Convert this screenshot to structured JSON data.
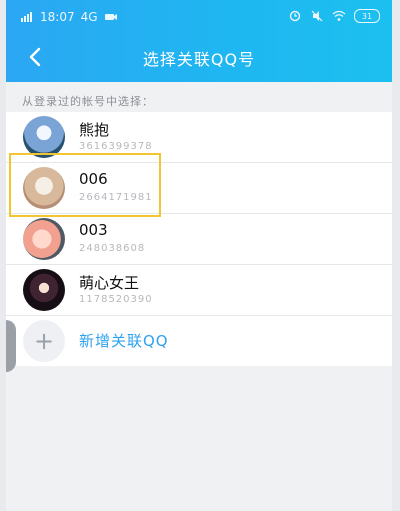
{
  "status_bar": {
    "time": "18:07",
    "network": "4G",
    "battery": "31"
  },
  "header": {
    "title": "选择关联QQ号"
  },
  "hint": "从登录过的帐号中选择：",
  "accounts": [
    {
      "name": "熊抱",
      "number": "3616399378",
      "avatar": "avatar-person-icon"
    },
    {
      "name": "006",
      "number": "2664171981",
      "avatar": "avatar-cat-icon"
    },
    {
      "name": "003",
      "number": "248038608",
      "avatar": "avatar-face-icon"
    },
    {
      "name": "萌心女王",
      "number": "1178520390",
      "avatar": "avatar-girl-icon"
    }
  ],
  "add_account": {
    "label": "新增关联QQ"
  },
  "colors": {
    "header_blue": "#1fb6f1",
    "accent_blue": "#2ea2ef",
    "highlight": "#f2c531"
  }
}
